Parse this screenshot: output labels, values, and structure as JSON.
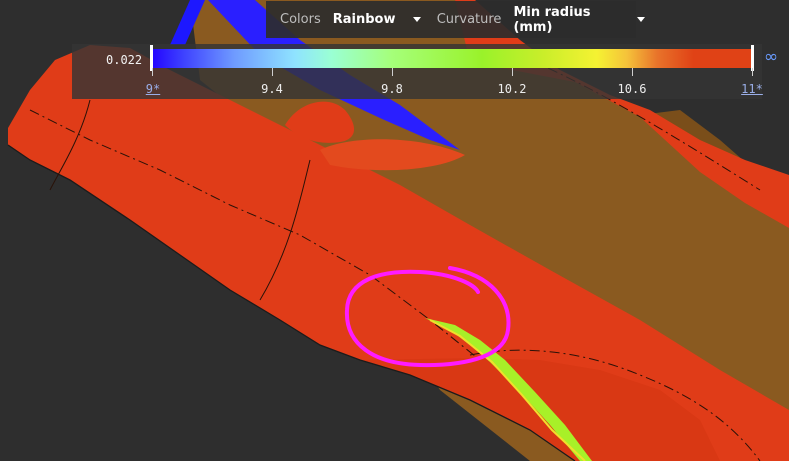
{
  "toolbar": {
    "colors_label": "Colors",
    "colors_value": "Rainbow",
    "curvature_label": "Curvature",
    "curvature_value": "Min radius (mm)"
  },
  "legend": {
    "min_value": "0.022",
    "ticks": [
      "9*",
      "9.4",
      "9.8",
      "10.2",
      "10.6",
      "11*"
    ],
    "max_symbol": "∞"
  },
  "colors": {
    "surface_red": "#e03c18",
    "surface_olive": "#8a5a20",
    "blue_edge": "#1d18ff",
    "annotation_magenta": "#ff1bff",
    "background": "#2e2e2e"
  }
}
